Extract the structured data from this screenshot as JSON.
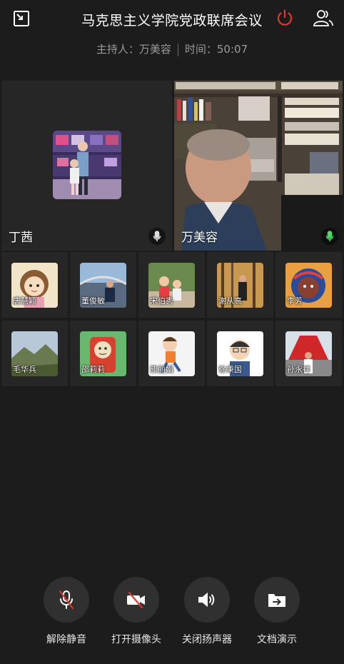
{
  "header": {
    "title": "马克思主义学院党政联席会议",
    "host_label": "主持人：万美容",
    "time_label": "时间：50:07"
  },
  "main_videos": [
    {
      "name": "丁茜"
    },
    {
      "name": "万美容"
    }
  ],
  "participants": [
    {
      "name": "唐慧颖",
      "icon": "cartoon-girl"
    },
    {
      "name": "董俊敏",
      "icon": "person-bridge"
    },
    {
      "name": "宋伯秀",
      "icon": "two-children"
    },
    {
      "name": "谢从高",
      "icon": "person-trees"
    },
    {
      "name": "李芳",
      "icon": "cartoon-hooded"
    },
    {
      "name": "毛华兵",
      "icon": "mountain-landscape"
    },
    {
      "name": "邵莉莉",
      "icon": "cartoon-red"
    },
    {
      "name": "熊丽娟",
      "icon": "cartoon-runner"
    },
    {
      "name": "徐秉国",
      "icon": "cartoon-man-glasses"
    },
    {
      "name": "孙永祥",
      "icon": "person-red-monument"
    }
  ],
  "controls": {
    "unmute": "解除静音",
    "camera_on": "打开摄像头",
    "speaker_off": "关闭扬声器",
    "doc_share": "文档演示"
  },
  "colors": {
    "background": "#1c1c1c",
    "tile": "#262626",
    "leave_red": "#e0382f",
    "active_mic_green": "#4cd964",
    "muted_red": "#e0382f"
  }
}
